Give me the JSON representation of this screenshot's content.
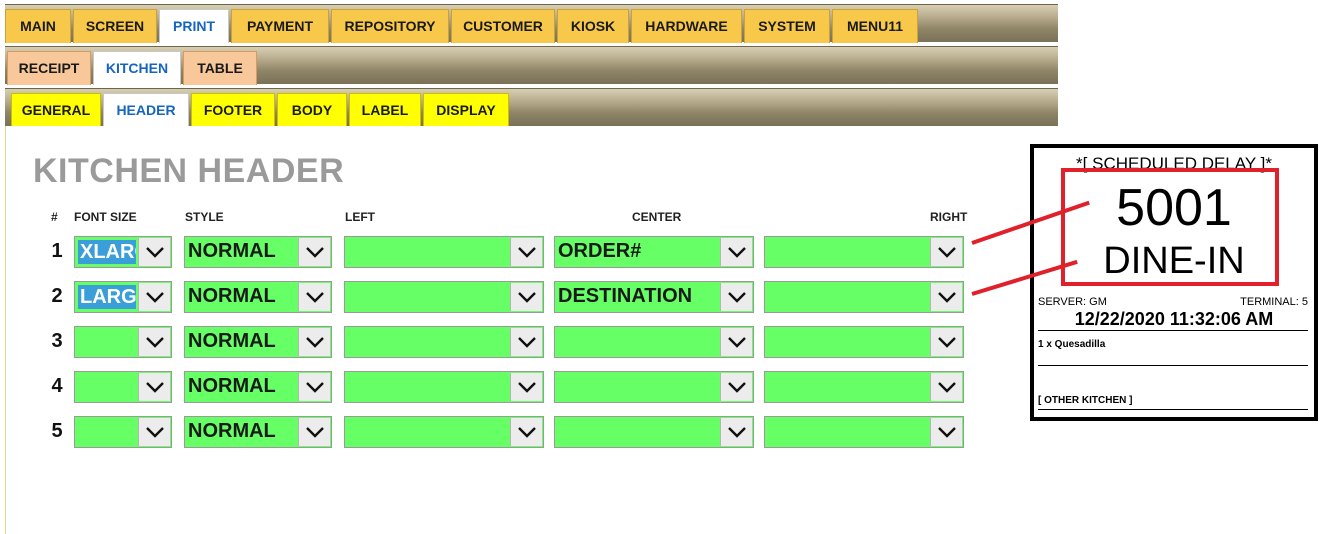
{
  "tabs": {
    "main": [
      "MAIN",
      "SCREEN",
      "PRINT",
      "PAYMENT",
      "REPOSITORY",
      "CUSTOMER",
      "KIOSK",
      "HARDWARE",
      "SYSTEM",
      "MENU11"
    ],
    "print": [
      "RECEIPT",
      "KITCHEN",
      "TABLE"
    ],
    "kitchen": [
      "GENERAL",
      "HEADER",
      "FOOTER",
      "BODY",
      "LABEL",
      "DISPLAY"
    ]
  },
  "page_title": "KITCHEN HEADER",
  "columns": {
    "num": "#",
    "font_size": "FONT SIZE",
    "style": "STYLE",
    "left": "LEFT",
    "center": "CENTER",
    "right": "RIGHT"
  },
  "rows": [
    {
      "num": "1",
      "font_size": "XLARG",
      "style": "NORMAL",
      "left": "",
      "center": "ORDER#",
      "right": ""
    },
    {
      "num": "2",
      "font_size": "LARGE",
      "style": "NORMAL",
      "left": "",
      "center": "DESTINATION",
      "right": ""
    },
    {
      "num": "3",
      "font_size": "",
      "style": "NORMAL",
      "left": "",
      "center": "",
      "right": ""
    },
    {
      "num": "4",
      "font_size": "",
      "style": "NORMAL",
      "left": "",
      "center": "",
      "right": ""
    },
    {
      "num": "5",
      "font_size": "",
      "style": "NORMAL",
      "left": "",
      "center": "",
      "right": ""
    }
  ],
  "receipt": {
    "scheduled": "*[ SCHEDULED DELAY ]*",
    "order_num": "5001",
    "destination": "DINE-IN",
    "server": "SERVER: GM",
    "terminal": "TERMINAL: 5",
    "datetime": "12/22/2020 11:32:06 AM",
    "item": "1 x Quesadilla",
    "other_kitchen": "[ OTHER KITCHEN ]"
  },
  "colors": {
    "field_green": "#66ff66",
    "tab_orange": "#f7c84a",
    "tab_peach": "#f8c89a",
    "tab_yellow": "#ffff00",
    "active_text": "#1565c0",
    "highlight": "#e0202a"
  }
}
